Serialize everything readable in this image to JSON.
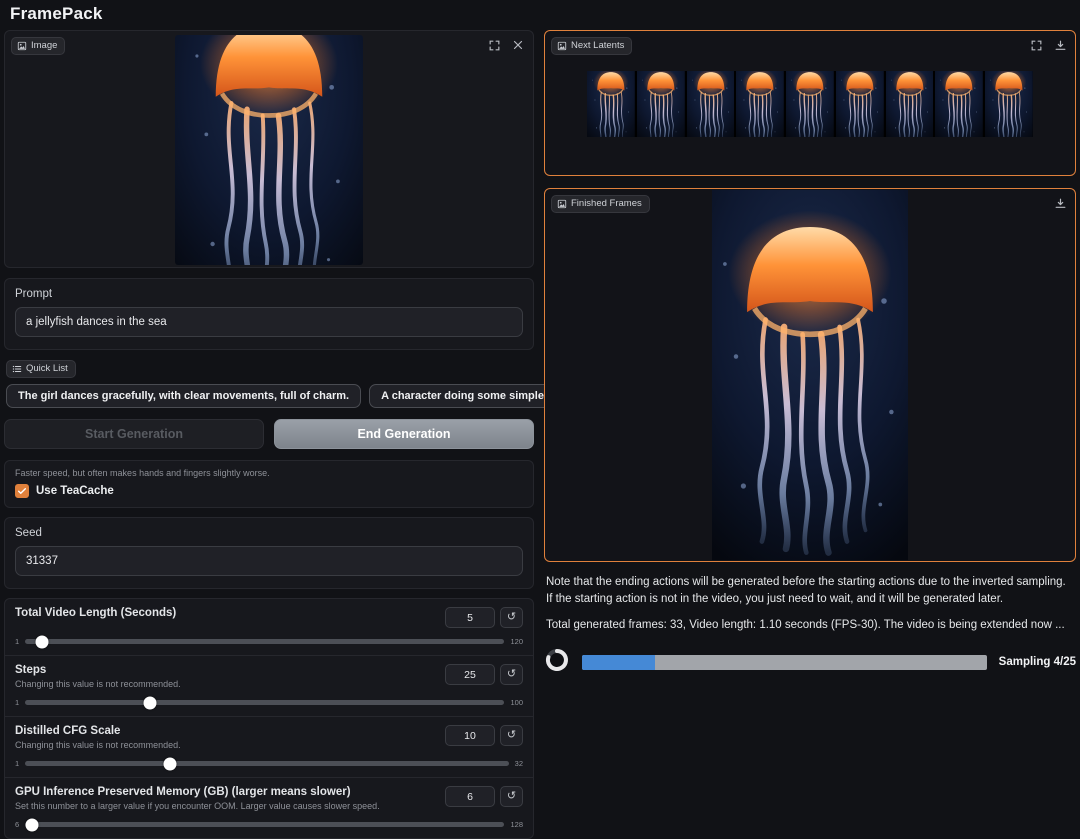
{
  "app": {
    "title": "FramePack"
  },
  "colors": {
    "accent": "#e0813c",
    "progress": "#4589d6"
  },
  "image_panel": {
    "label": "Image"
  },
  "prompt": {
    "label": "Prompt",
    "value": "a jellyfish dances in the sea"
  },
  "quick_list": {
    "label": "Quick List",
    "items": [
      "The girl dances gracefully, with clear movements, full of charm.",
      "A character doing some simple body movements."
    ]
  },
  "actions": {
    "start": "Start Generation",
    "end": "End Generation"
  },
  "teacache": {
    "note": "Faster speed, but often makes hands and fingers slightly worse.",
    "label": "Use TeaCache",
    "checked": true
  },
  "seed": {
    "label": "Seed",
    "value": "31337"
  },
  "sliders": [
    {
      "label": "Total Video Length (Seconds)",
      "note": "",
      "value": "5",
      "min": "1",
      "max": "120",
      "percent": 3.5
    },
    {
      "label": "Steps",
      "note": "Changing this value is not recommended.",
      "value": "25",
      "min": "1",
      "max": "100",
      "percent": 26
    },
    {
      "label": "Distilled CFG Scale",
      "note": "Changing this value is not recommended.",
      "value": "10",
      "min": "1",
      "max": "32",
      "percent": 30
    },
    {
      "label": "GPU Inference Preserved Memory (GB) (larger means slower)",
      "note": "Set this number to a larger value if you encounter OOM. Larger value causes slower speed.",
      "value": "6",
      "min": "6",
      "max": "128",
      "percent": 1.5
    }
  ],
  "next_latents": {
    "label": "Next Latents",
    "frame_count": 9
  },
  "finished_frames": {
    "label": "Finished Frames"
  },
  "status": {
    "note": "Note that the ending actions will be generated before the starting actions due to the inverted sampling. If the starting action is not in the video, you just need to wait, and it will be generated later.",
    "summary": "Total generated frames: 33, Video length: 1.10 seconds (FPS-30). The video is being extended now ...",
    "progress_label": "Sampling 4/25",
    "progress_percent": 18
  }
}
